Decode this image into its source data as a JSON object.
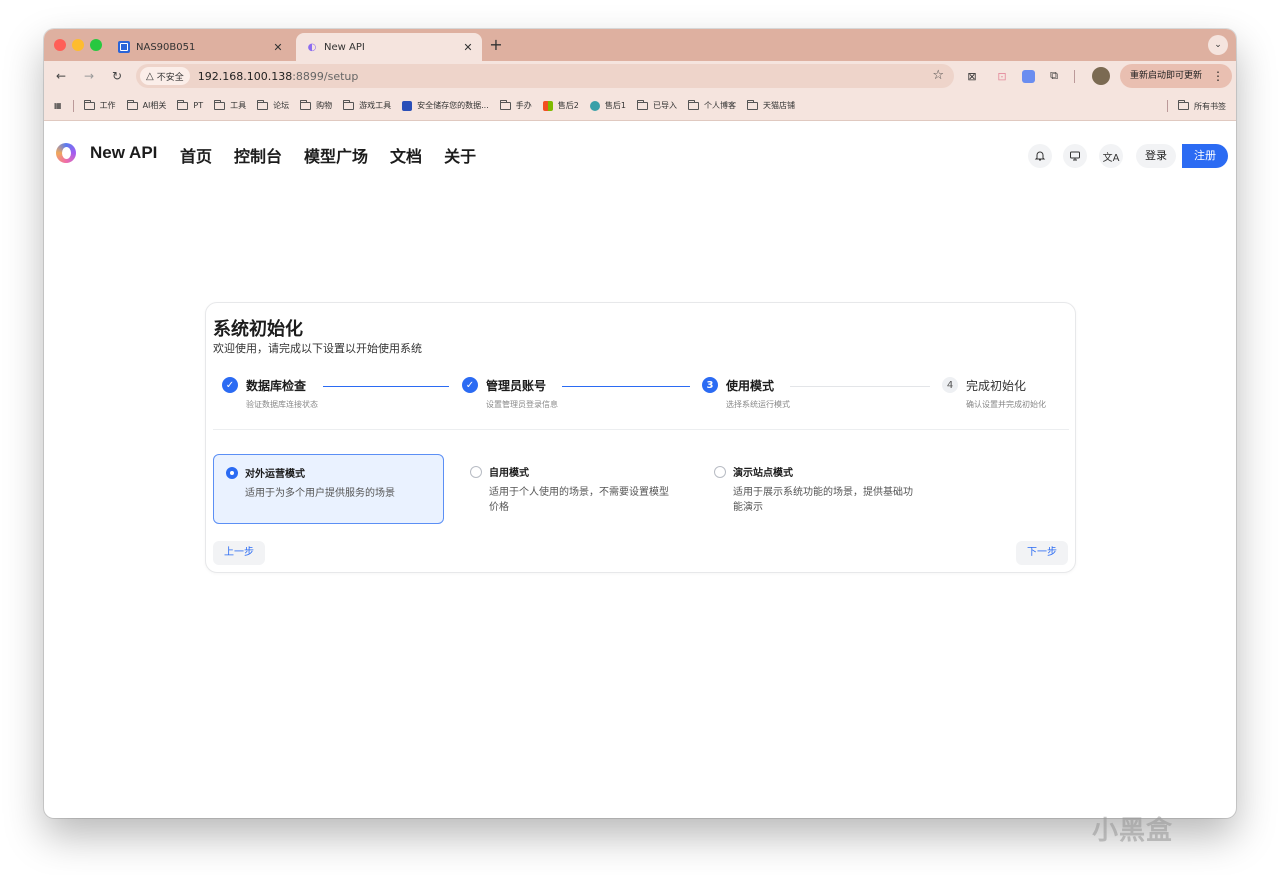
{
  "browser": {
    "tabs": [
      {
        "title": "NAS90B051",
        "close": "✕"
      },
      {
        "title": "New API",
        "close": "✕"
      }
    ],
    "new_tab": "+",
    "url_warning": "不安全",
    "url_host": "192.168.100.138",
    "url_path": ":8899/setup",
    "update_button": "重新启动即可更新",
    "bookmarks": [
      {
        "label": "工作",
        "icon": "folder-icon"
      },
      {
        "label": "AI相关",
        "icon": "folder-icon"
      },
      {
        "label": "PT",
        "icon": "folder-icon"
      },
      {
        "label": "工具",
        "icon": "folder-icon"
      },
      {
        "label": "论坛",
        "icon": "folder-icon"
      },
      {
        "label": "购物",
        "icon": "folder-icon"
      },
      {
        "label": "游戏工具",
        "icon": "folder-icon"
      },
      {
        "label": "安全储存您的数据...",
        "icon": "nas-icon"
      },
      {
        "label": "手办",
        "icon": "folder-icon"
      },
      {
        "label": "售后2",
        "icon": "microsoft-icon"
      },
      {
        "label": "售后1",
        "icon": "app-icon"
      },
      {
        "label": "已导入",
        "icon": "folder-icon"
      },
      {
        "label": "个人博客",
        "icon": "folder-icon"
      },
      {
        "label": "天猫店铺",
        "icon": "folder-icon"
      }
    ],
    "all_bookmarks": "所有书签"
  },
  "app": {
    "brand": "New API",
    "nav": [
      "首页",
      "控制台",
      "模型广场",
      "文档",
      "关于"
    ],
    "login": "登录",
    "register": "注册"
  },
  "setup": {
    "title": "系统初始化",
    "subtitle": "欢迎使用，请完成以下设置以开始使用系统",
    "steps": [
      {
        "number": "✓",
        "title": "数据库检查",
        "desc": "验证数据库连接状态",
        "status": "done"
      },
      {
        "number": "✓",
        "title": "管理员账号",
        "desc": "设置管理员登录信息",
        "status": "done"
      },
      {
        "number": "3",
        "title": "使用模式",
        "desc": "选择系统运行模式",
        "status": "current"
      },
      {
        "number": "4",
        "title": "完成初始化",
        "desc": "确认设置并完成初始化",
        "status": "todo"
      }
    ],
    "modes": [
      {
        "title": "对外运营模式",
        "desc": "适用于为多个用户提供服务的场景",
        "selected": true
      },
      {
        "title": "自用模式",
        "desc": "适用于个人使用的场景，不需要设置模型价格",
        "selected": false
      },
      {
        "title": "演示站点模式",
        "desc": "适用于展示系统功能的场景，提供基础功能演示",
        "selected": false
      }
    ],
    "prev": "上一步",
    "next": "下一步"
  },
  "watermark": "小黑盒",
  "colors": {
    "primary": "#2b6bf3",
    "tab_strip": "#deb0a0",
    "toolbar": "#f5e4de"
  }
}
